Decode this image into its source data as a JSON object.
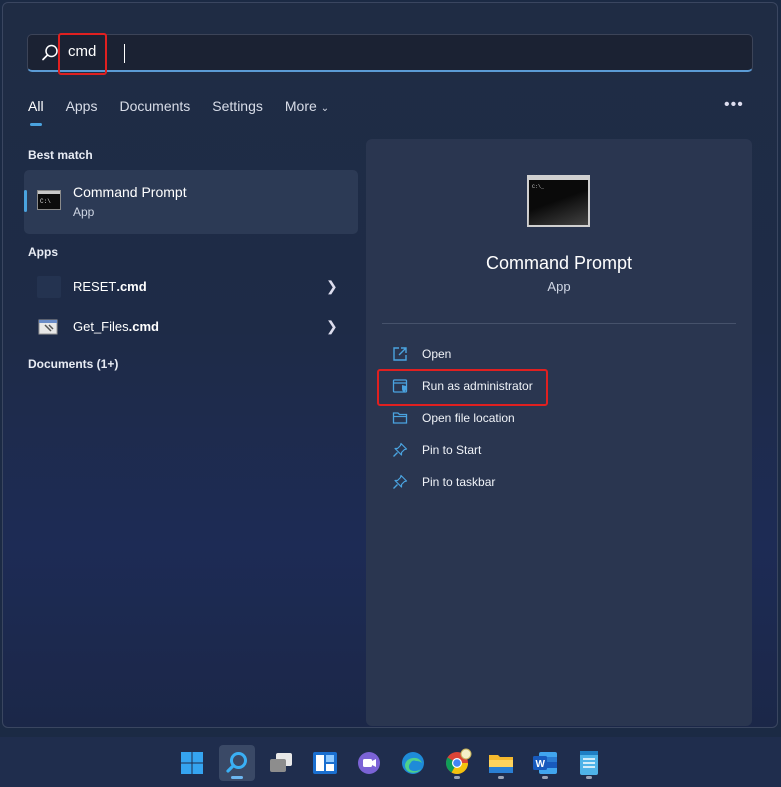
{
  "search": {
    "value": "cmd"
  },
  "tabs": [
    {
      "label": "All"
    },
    {
      "label": "Apps"
    },
    {
      "label": "Documents"
    },
    {
      "label": "Settings"
    },
    {
      "label": "More"
    }
  ],
  "best_match": {
    "section": "Best match",
    "title": "Command Prompt",
    "subtitle": "App"
  },
  "apps": {
    "section": "Apps",
    "items": [
      {
        "label_base": "RESET",
        "label_ext": ".cmd"
      },
      {
        "label_base": "Get_Files",
        "label_ext": ".cmd"
      }
    ]
  },
  "documents": {
    "section": "Documents (1+)"
  },
  "detail": {
    "title": "Command Prompt",
    "subtitle": "App",
    "actions": [
      {
        "label": "Open",
        "icon": "open-icon"
      },
      {
        "label": "Run as administrator",
        "icon": "shield-icon"
      },
      {
        "label": "Open file location",
        "icon": "folder-icon"
      },
      {
        "label": "Pin to Start",
        "icon": "pin-icon"
      },
      {
        "label": "Pin to taskbar",
        "icon": "pin-icon"
      }
    ]
  },
  "taskbar": {
    "icons": [
      "windows-start-icon",
      "search-icon",
      "task-view-icon",
      "widgets-icon",
      "chat-icon",
      "edge-icon",
      "chrome-icon",
      "file-explorer-icon",
      "word-icon",
      "notepad-icon"
    ]
  },
  "colors": {
    "accent": "#4aa3df",
    "highlight": "#e02020"
  }
}
